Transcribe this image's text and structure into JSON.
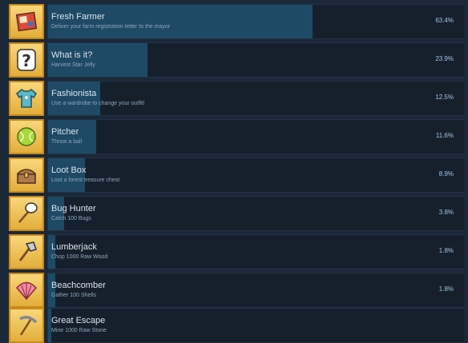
{
  "achievements": [
    {
      "title": "Fresh Farmer",
      "description": "Deliver your farm registration letter to the mayor",
      "percent_label": "63.4%",
      "percent": 63.4,
      "icon": "letter-icon"
    },
    {
      "title": "What is it?",
      "description": "Harvest Star Jelly",
      "percent_label": "23.9%",
      "percent": 23.9,
      "icon": "question-mark-icon"
    },
    {
      "title": "Fashionista",
      "description": "Use a wardrobe to change your outfit!",
      "percent_label": "12.5%",
      "percent": 12.5,
      "icon": "shirt-icon"
    },
    {
      "title": "Pitcher",
      "description": "Throw a ball",
      "percent_label": "11.6%",
      "percent": 11.6,
      "icon": "ball-icon"
    },
    {
      "title": "Loot Box",
      "description": "Loot a forest treasure chest",
      "percent_label": "8.9%",
      "percent": 8.9,
      "icon": "chest-icon"
    },
    {
      "title": "Bug Hunter",
      "description": "Catch 100 Bugs",
      "percent_label": "3.8%",
      "percent": 3.8,
      "icon": "net-icon"
    },
    {
      "title": "Lumberjack",
      "description": "Chop 1000 Raw Wood",
      "percent_label": "1.8%",
      "percent": 1.8,
      "icon": "axe-icon"
    },
    {
      "title": "Beachcomber",
      "description": "Gather 100 Shells",
      "percent_label": "1.8%",
      "percent": 1.8,
      "icon": "shell-icon"
    },
    {
      "title": "Great Escape",
      "description": "Mine 1000 Raw Stone",
      "percent_label": "",
      "percent": 0.8,
      "icon": "pickaxe-icon"
    }
  ],
  "colors": {
    "background": "#1b2838",
    "bar_fill": "#1e4a66",
    "icon_frame": "#e2ae3a"
  }
}
